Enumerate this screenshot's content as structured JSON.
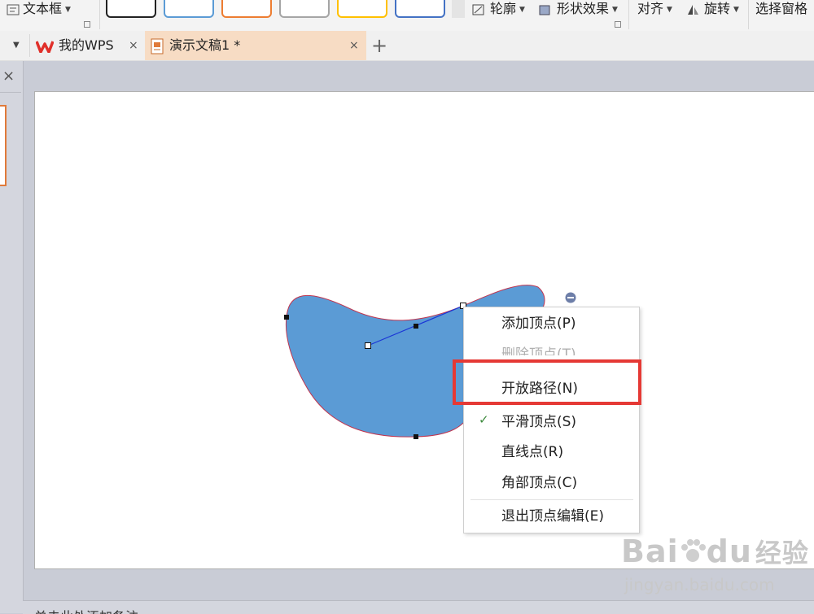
{
  "ribbon": {
    "textbox_label": "文本框",
    "outline_label": "轮廓",
    "shape_effect_label": "形状效果",
    "align_label": "对齐",
    "rotate_label": "旋转",
    "selection_pane_label": "选择窗格",
    "swatch_colors": [
      "#222222",
      "#5b9bd5",
      "#ed7d31",
      "#a5a5a5",
      "#ffc000",
      "#4472c4"
    ]
  },
  "tabs": {
    "home_label": "我的WPS",
    "doc_label": "演示文稿1 *",
    "close_glyph": "×",
    "new_tab_glyph": "+"
  },
  "shape": {
    "fill": "#5b9bd5",
    "outline": "#c0354f"
  },
  "context_menu": {
    "items": [
      {
        "label": "添加顶点(P)",
        "enabled": true,
        "checked": false
      },
      {
        "label": "删除顶点(T)",
        "enabled": false,
        "checked": false
      },
      {
        "label": "开放路径(N)",
        "enabled": true,
        "checked": false
      },
      {
        "label": "平滑顶点(S)",
        "enabled": true,
        "checked": true
      },
      {
        "label": "直线点(R)",
        "enabled": true,
        "checked": false
      },
      {
        "label": "角部顶点(C)",
        "enabled": true,
        "checked": false
      },
      {
        "label": "退出顶点编辑(E)",
        "enabled": true,
        "checked": false
      }
    ],
    "check_glyph": "✓"
  },
  "annotation": {
    "highlight_color": "#e53935"
  },
  "watermark": {
    "brand": "Bai",
    "brand2": "du",
    "brand_cn": "经验",
    "url": "jingyan.baidu.com"
  },
  "status": {
    "text": "单击此处添加备注"
  }
}
